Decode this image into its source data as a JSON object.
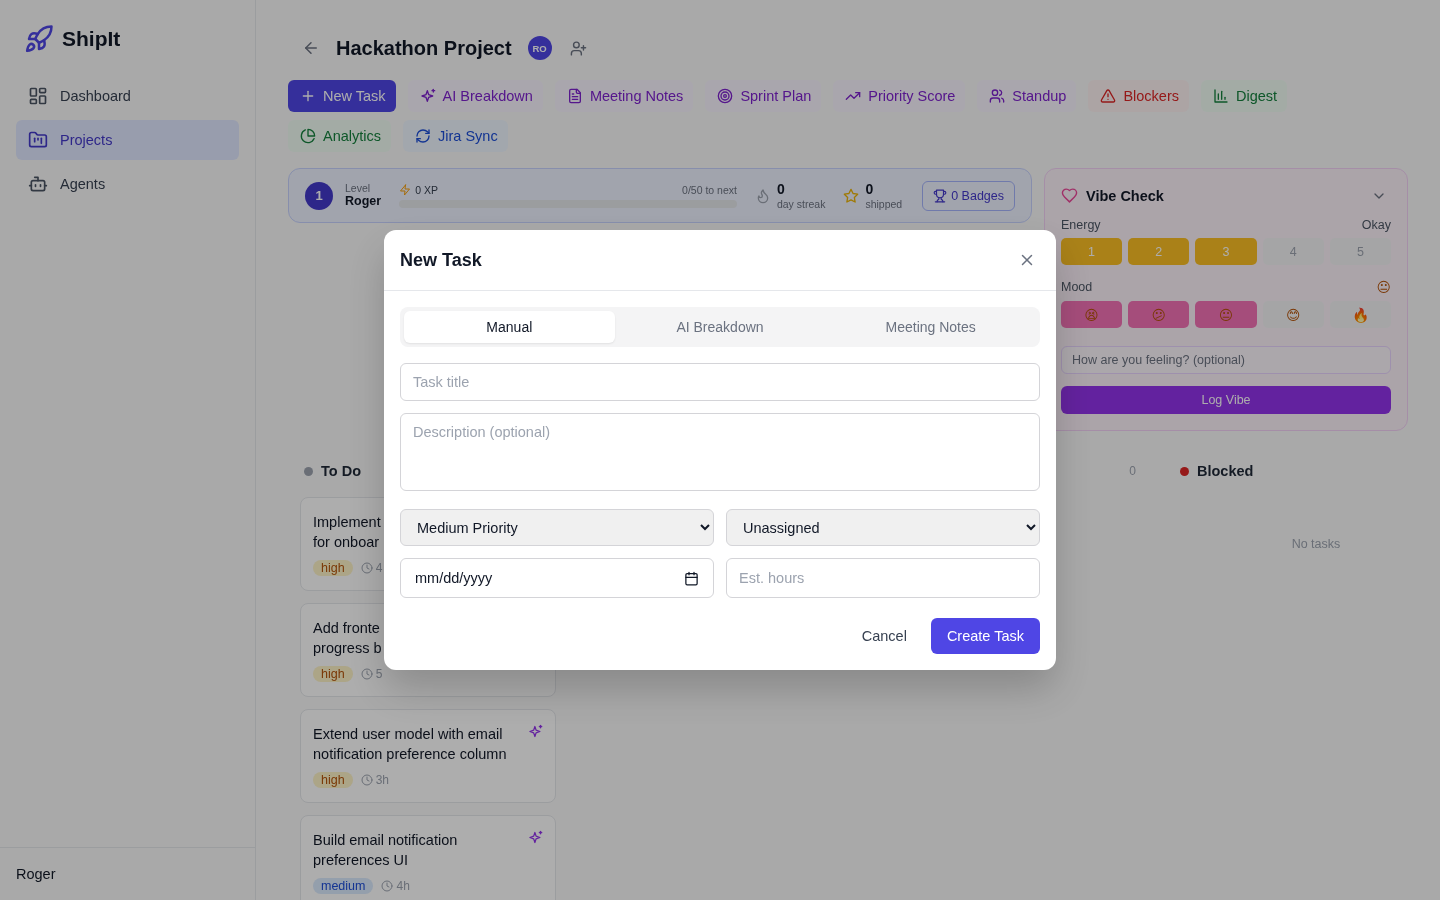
{
  "sidebar": {
    "brand": "ShipIt",
    "items": [
      {
        "label": "Dashboard",
        "selected": false
      },
      {
        "label": "Projects",
        "selected": true
      },
      {
        "label": "Agents",
        "selected": false
      }
    ],
    "user": "Roger"
  },
  "header": {
    "title": "Hackathon Project",
    "avatar": "RO"
  },
  "actions": [
    {
      "label": "New Task",
      "kind": "primary"
    },
    {
      "label": "AI Breakdown",
      "kind": "purple"
    },
    {
      "label": "Meeting Notes",
      "kind": "purple"
    },
    {
      "label": "Sprint Plan",
      "kind": "purple"
    },
    {
      "label": "Priority Score",
      "kind": "purple"
    },
    {
      "label": "Standup",
      "kind": "purple"
    },
    {
      "label": "Blockers",
      "kind": "danger"
    },
    {
      "label": "Digest",
      "kind": "success"
    },
    {
      "label": "Analytics",
      "kind": "success"
    },
    {
      "label": "Jira Sync",
      "kind": "info"
    }
  ],
  "stats": {
    "level_number": "1",
    "level_label": "Level",
    "name": "Roger",
    "xp": "0 XP",
    "xp_next": "0/50 to next",
    "level": 0,
    "streak": "0",
    "streak_label": "day streak",
    "shipped": "0",
    "shipped_label": "shipped",
    "badges": "0 Badges"
  },
  "vibe_check": {
    "title": "Vibe Check",
    "energy_label": "Energy",
    "energy_value": "Okay",
    "energy": [
      {
        "label": "1",
        "filled": true
      },
      {
        "label": "2",
        "filled": true
      },
      {
        "label": "3",
        "filled": true
      },
      {
        "label": "4",
        "filled": false
      },
      {
        "label": "5",
        "filled": false
      }
    ],
    "mood_label": "Mood",
    "mood_value": "😐",
    "moods": [
      {
        "label": "😫",
        "filled": true
      },
      {
        "label": "😕",
        "filled": true
      },
      {
        "label": "😐",
        "filled": true
      },
      {
        "label": "😊",
        "filled": false
      },
      {
        "label": "🔥",
        "filled": false
      }
    ],
    "note_placeholder": "How are you feeling? (optional)",
    "button": "Log Vibe"
  },
  "board": {
    "columns": [
      {
        "title": "To Do",
        "color": "#6a6f77",
        "cards": [
          {
            "title": "Implement\nfor onboar",
            "tag": {
              "label": "high",
              "kind": "high"
            },
            "hours": "4",
            "ai": false
          },
          {
            "title": "Add fronte\nprogress b",
            "tag": {
              "label": "high",
              "kind": "high"
            },
            "hours": "5",
            "ai": false
          },
          {
            "title": "Extend user model with email notification preference column",
            "tag": {
              "label": "high",
              "kind": "high"
            },
            "hours": "3h",
            "ai": true
          },
          {
            "title": "Build email notification preferences UI",
            "tag": {
              "label": "medium",
              "kind": "medium"
            },
            "hours": "4h",
            "ai": true
          }
        ]
      },
      {
        "count": "0"
      },
      {
        "title": "Blocked",
        "color": "#961a1a",
        "empty": "No tasks"
      }
    ]
  },
  "modal": {
    "title": "New Task",
    "tabs": [
      {
        "label": "Manual",
        "selected": true
      },
      {
        "label": "AI Breakdown",
        "selected": false
      },
      {
        "label": "Meeting Notes",
        "selected": false
      }
    ],
    "title_placeholder": "Task title",
    "description_placeholder": "Description (optional)",
    "priority": "Medium Priority",
    "assignee": "Unassigned",
    "due_date": "mm/dd/yyyy",
    "hours_placeholder": "Est. hours",
    "cancel": "Cancel",
    "submit": "Create Task"
  }
}
